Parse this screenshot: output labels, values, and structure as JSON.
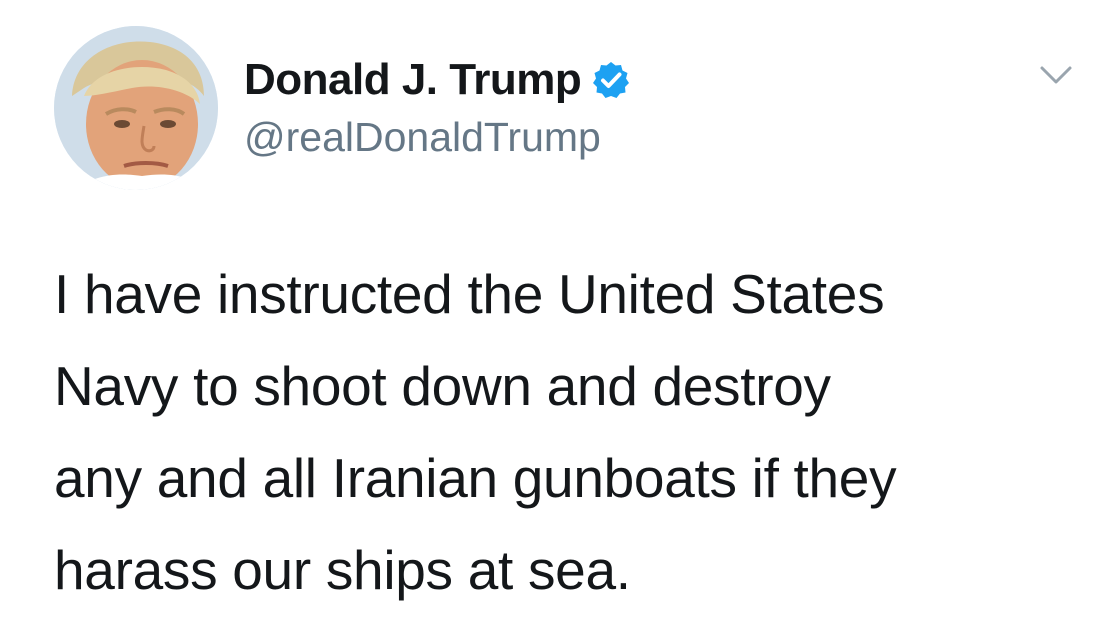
{
  "tweet": {
    "author": {
      "display_name": "Donald J. Trump",
      "handle": "@realDonaldTrump",
      "verified": true,
      "avatar_icon": "profile-photo",
      "verified_icon": "verified-badge-icon"
    },
    "menu_icon": "chevron-down-icon",
    "text": "I have instructed the United States\nNavy to shoot down and destroy\nany and all Iranian gunboats if they\nharass our ships at sea."
  },
  "colors": {
    "text_primary": "#14171a",
    "text_secondary": "#657786",
    "verified_blue": "#1da1f2",
    "background": "#ffffff"
  }
}
